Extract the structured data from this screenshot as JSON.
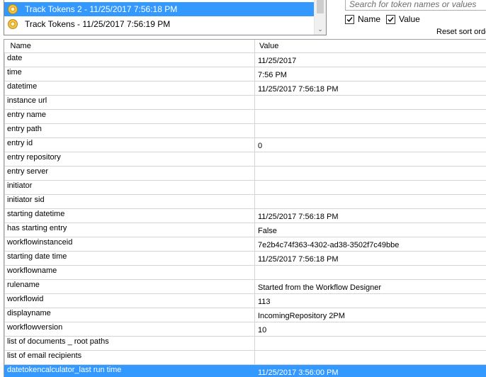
{
  "tracks": [
    {
      "label": "Track Tokens 2 - 11/25/2017 7:56:18 PM",
      "selected": true,
      "icon": "token-icon"
    },
    {
      "label": "Track Tokens - 11/25/2017 7:56:19 PM",
      "selected": false,
      "icon": "token-icon"
    }
  ],
  "search": {
    "placeholder": "Search for token names or values"
  },
  "filters": {
    "name_label": "Name",
    "value_label": "Value",
    "name_checked": true,
    "value_checked": true
  },
  "reset_label": "Reset sort orde",
  "grid": {
    "headers": {
      "name": "Name",
      "value": "Value"
    },
    "rows": [
      {
        "name": "date",
        "value": "11/25/2017"
      },
      {
        "name": "time",
        "value": "7:56 PM"
      },
      {
        "name": "datetime",
        "value": "11/25/2017 7:56:18 PM"
      },
      {
        "name": "instance url",
        "value": ""
      },
      {
        "name": "entry name",
        "value": ""
      },
      {
        "name": "entry path",
        "value": ""
      },
      {
        "name": "entry id",
        "value": "0"
      },
      {
        "name": "entry repository",
        "value": ""
      },
      {
        "name": "entry server",
        "value": ""
      },
      {
        "name": "initiator",
        "value": ""
      },
      {
        "name": "initiator sid",
        "value": ""
      },
      {
        "name": "starting datetime",
        "value": "11/25/2017 7:56:18 PM"
      },
      {
        "name": "has starting entry",
        "value": "False"
      },
      {
        "name": "workflowinstanceid",
        "value": "7e2b4c74f363-4302-ad38-3502f7c49bbe"
      },
      {
        "name": "starting date time",
        "value": "11/25/2017 7:56:18 PM"
      },
      {
        "name": "workflowname",
        "value": ""
      },
      {
        "name": "rulename",
        "value": "Started from the Workflow Designer"
      },
      {
        "name": "workflowid",
        "value": "113"
      },
      {
        "name": "displayname",
        "value": "IncomingRepository 2PM"
      },
      {
        "name": "workflowversion",
        "value": "10"
      },
      {
        "name": "list of documents _ root paths",
        "value": ""
      },
      {
        "name": "list of email recipients",
        "value": ""
      },
      {
        "name": "datetokencalculator_last run time",
        "value": "11/25/2017 3:56:00 PM",
        "selected": true
      }
    ]
  },
  "colors": {
    "selection": "#3399ff",
    "token_icon": "#f2c14e"
  }
}
